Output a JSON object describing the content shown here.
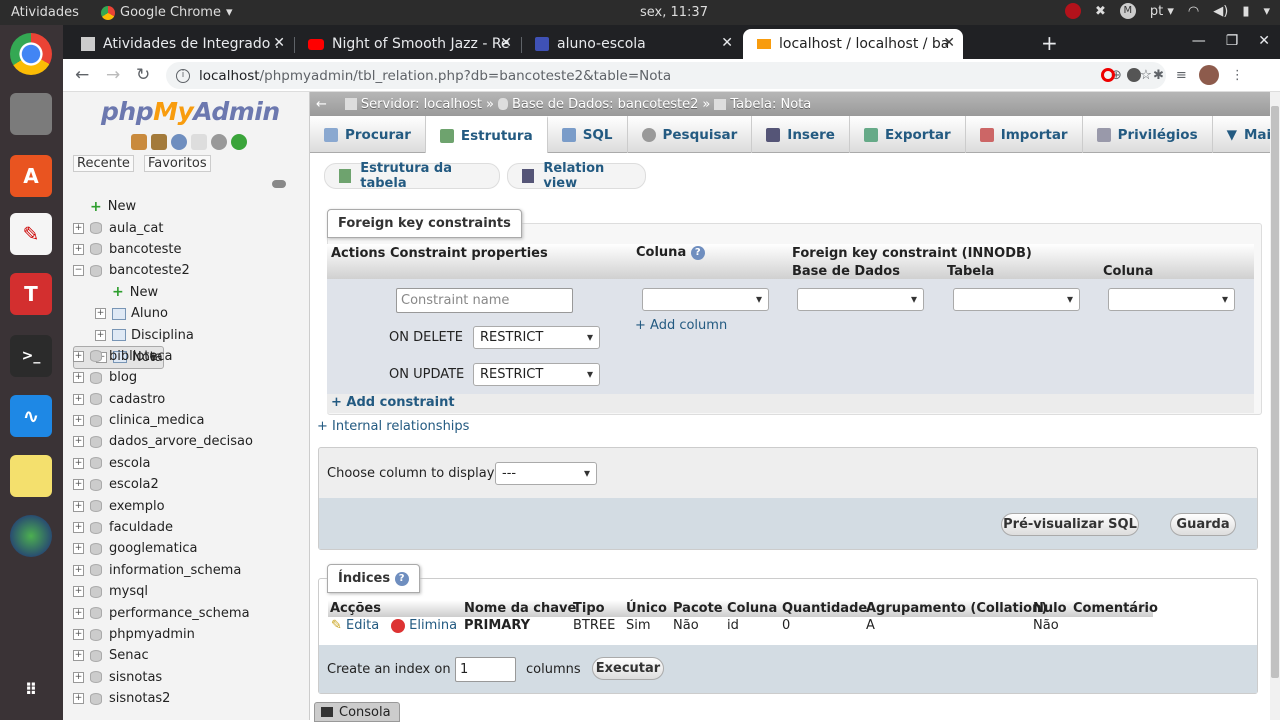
{
  "os": {
    "activities": "Atividades",
    "app_name": "Google Chrome",
    "clock": "sex, 11:37",
    "lang": "pt"
  },
  "browser": {
    "tabs": [
      {
        "title": "Atividades de Integrado ."
      },
      {
        "title": "Night of Smooth Jazz - Re"
      },
      {
        "title": "aluno-escola"
      },
      {
        "title": "localhost / localhost / ba"
      }
    ],
    "url_host": "localhost",
    "url_path": "/phpmyadmin/tbl_relation.php?db=bancoteste2&table=Nota"
  },
  "pma": {
    "logo_php": "php",
    "logo_my": "My",
    "logo_admin": "Admin",
    "recent": "Recente",
    "favorites": "Favoritos",
    "tree": [
      {
        "label": "New",
        "kind": "new",
        "indent": 0
      },
      {
        "label": "aula_cat",
        "kind": "db",
        "indent": 0
      },
      {
        "label": "bancoteste",
        "kind": "db",
        "indent": 0
      },
      {
        "label": "bancoteste2",
        "kind": "db-open",
        "indent": 0
      },
      {
        "label": "New",
        "kind": "new",
        "indent": 1
      },
      {
        "label": "Aluno",
        "kind": "table",
        "indent": 1
      },
      {
        "label": "Disciplina",
        "kind": "table",
        "indent": 1
      },
      {
        "label": "Nota",
        "kind": "table-sel",
        "indent": 1
      },
      {
        "label": "biblioteca",
        "kind": "db",
        "indent": 0
      },
      {
        "label": "blog",
        "kind": "db",
        "indent": 0
      },
      {
        "label": "cadastro",
        "kind": "db",
        "indent": 0
      },
      {
        "label": "clinica_medica",
        "kind": "db",
        "indent": 0
      },
      {
        "label": "dados_arvore_decisao",
        "kind": "db",
        "indent": 0
      },
      {
        "label": "escola",
        "kind": "db",
        "indent": 0
      },
      {
        "label": "escola2",
        "kind": "db",
        "indent": 0
      },
      {
        "label": "exemplo",
        "kind": "db",
        "indent": 0
      },
      {
        "label": "faculdade",
        "kind": "db",
        "indent": 0
      },
      {
        "label": "googlematica",
        "kind": "db",
        "indent": 0
      },
      {
        "label": "information_schema",
        "kind": "db",
        "indent": 0
      },
      {
        "label": "mysql",
        "kind": "db",
        "indent": 0
      },
      {
        "label": "performance_schema",
        "kind": "db",
        "indent": 0
      },
      {
        "label": "phpmyadmin",
        "kind": "db",
        "indent": 0
      },
      {
        "label": "Senac",
        "kind": "db",
        "indent": 0
      },
      {
        "label": "sisnotas",
        "kind": "db",
        "indent": 0
      },
      {
        "label": "sisnotas2",
        "kind": "db",
        "indent": 0
      }
    ],
    "breadcrumb": {
      "server": "Servidor: localhost",
      "db": "Base de Dados: bancoteste2",
      "table": "Tabela: Nota"
    },
    "menu": [
      "Procurar",
      "Estrutura",
      "SQL",
      "Pesquisar",
      "Insere",
      "Exportar",
      "Importar",
      "Privilégios",
      "Mais"
    ],
    "sub": {
      "structure": "Estrutura da tabela",
      "relation": "Relation view"
    },
    "fk": {
      "legend": "Foreign key constraints",
      "col_actions": "Actions",
      "col_props": "Constraint properties",
      "col_coluna": "Coluna",
      "col_fk": "Foreign key constraint (INNODB)",
      "col_base": "Base de Dados",
      "col_tabela": "Tabela",
      "col_coluna2": "Coluna",
      "constraint_placeholder": "Constraint name",
      "on_delete_label": "ON DELETE",
      "on_delete_value": "RESTRICT",
      "on_update_label": "ON UPDATE",
      "on_update_value": "RESTRICT",
      "add_column": "+ Add column",
      "add_constraint": "+ Add constraint",
      "internal": "+ Internal relationships"
    },
    "display": {
      "label": "Choose column to display:",
      "value": "---",
      "preview": "Pré-visualizar SQL",
      "save": "Guarda"
    },
    "indices": {
      "legend": "Índices",
      "headers": [
        "Acções",
        "Nome da chave",
        "Tipo",
        "Único",
        "Pacote",
        "Coluna",
        "Quantidade",
        "Agrupamento (Collation)",
        "Nulo",
        "Comentário"
      ],
      "row": {
        "edit": "Edita",
        "drop": "Elimina",
        "name": "PRIMARY",
        "type": "BTREE",
        "unique": "Sim",
        "packed": "Não",
        "column": "id",
        "cardinality": "0",
        "collation": "A",
        "null": "Não",
        "comment": ""
      },
      "create_prefix": "Create an index on",
      "create_count": "1",
      "create_suffix": "columns",
      "execute": "Executar"
    },
    "console": "Consola"
  }
}
